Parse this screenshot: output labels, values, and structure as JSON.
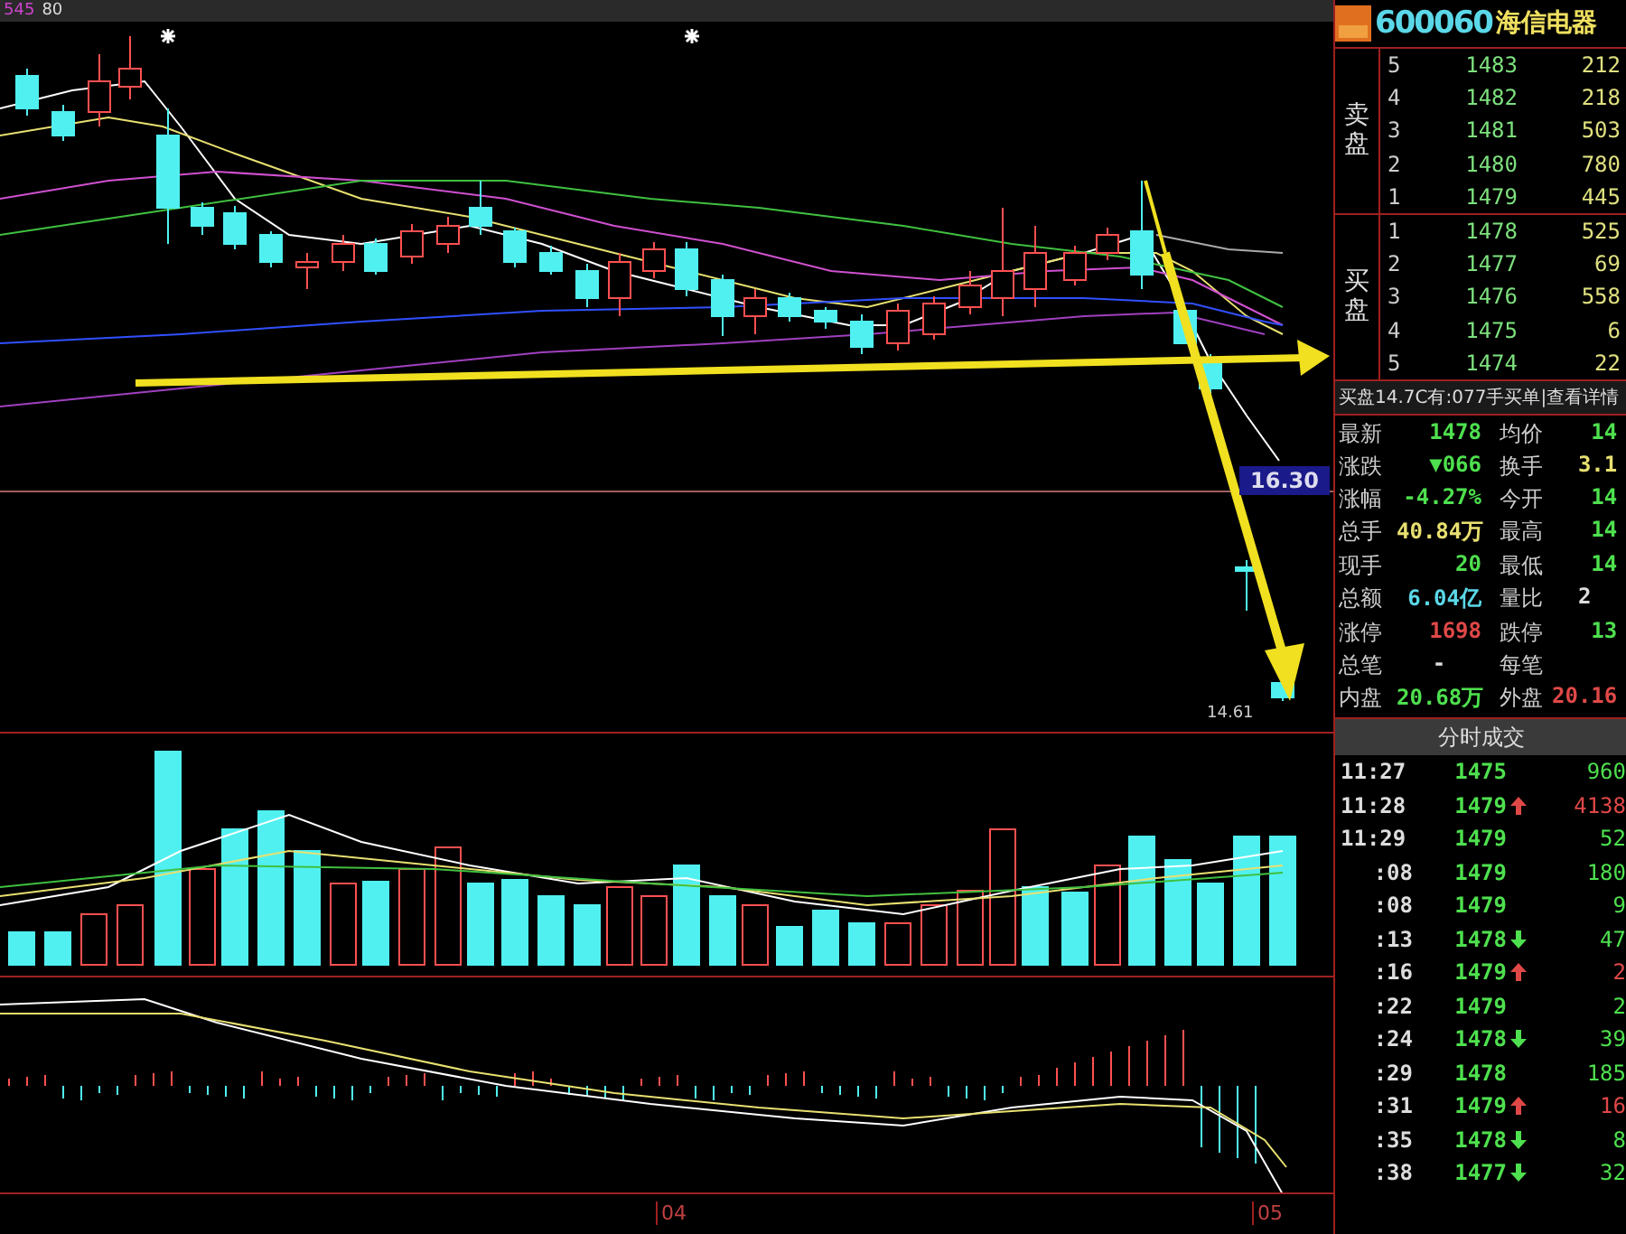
{
  "chart": {
    "ma_label": "545",
    "count_label": "80",
    "price_tag": "16.30",
    "low_label": "14.61",
    "date_labels": [
      "04",
      "05"
    ]
  },
  "quote": {
    "code": "600060",
    "name": "海信电器",
    "sell_label": "卖盘",
    "buy_label": "买盘",
    "asks": [
      {
        "level": "5",
        "price": "1483",
        "volume": "212"
      },
      {
        "level": "4",
        "price": "1482",
        "volume": "218"
      },
      {
        "level": "3",
        "price": "1481",
        "volume": "503"
      },
      {
        "level": "2",
        "price": "1480",
        "volume": "780"
      },
      {
        "level": "1",
        "price": "1479",
        "volume": "445"
      }
    ],
    "bids": [
      {
        "level": "1",
        "price": "1478",
        "volume": "525"
      },
      {
        "level": "2",
        "price": "1477",
        "volume": "69"
      },
      {
        "level": "3",
        "price": "1476",
        "volume": "558"
      },
      {
        "level": "4",
        "price": "1475",
        "volume": "6"
      },
      {
        "level": "5",
        "price": "1474",
        "volume": "22"
      }
    ],
    "info_line": "买盘14.7C有:077手买单|查看详情"
  },
  "stats": [
    {
      "label": "最新",
      "value": "1478",
      "color": "#4ee04e"
    },
    {
      "label": "均价",
      "value": "14",
      "color": "#4ee04e"
    },
    {
      "label": "涨跌",
      "value": "▼066",
      "color": "#4ee04e"
    },
    {
      "label": "换手",
      "value": "3.1",
      "color": "#e8e070"
    },
    {
      "label": "涨幅",
      "value": "-4.27%",
      "color": "#4ee04e"
    },
    {
      "label": "今开",
      "value": "14",
      "color": "#4ee04e"
    },
    {
      "label": "总手",
      "value": "40.84万",
      "color": "#e8e070"
    },
    {
      "label": "最高",
      "value": "14",
      "color": "#4ee04e"
    },
    {
      "label": "现手",
      "value": "20",
      "color": "#4ee04e"
    },
    {
      "label": "最低",
      "value": "14",
      "color": "#4ee04e"
    },
    {
      "label": "总额",
      "value": "6.04亿",
      "color": "#5bd8e8"
    },
    {
      "label": "量比",
      "value": "2",
      "color": "#dddddd"
    },
    {
      "label": "涨停",
      "value": "1698",
      "color": "#e04848"
    },
    {
      "label": "跌停",
      "value": "13",
      "color": "#4ee04e"
    },
    {
      "label": "总笔",
      "value": "-",
      "color": "#dddddd"
    },
    {
      "label": "每笔"
    },
    {
      "label": "内盘",
      "value": "20.68万",
      "color": "#4ee04e"
    },
    {
      "label": "外盘",
      "value": "20.16",
      "color": "#e04848"
    }
  ],
  "trades_tab": "分时成交",
  "trades": [
    {
      "time": "11:27",
      "price": "1475",
      "kind": "plain",
      "volume": "960",
      "color": "#4ee04e"
    },
    {
      "time": "11:28",
      "price": "1479",
      "kind": "up",
      "volume": "4138",
      "color": "#e04848"
    },
    {
      "time": "11:29",
      "price": "1479",
      "kind": "plain",
      "volume": "52",
      "color": "#4ee04e"
    },
    {
      "time": ":08",
      "price": "1479",
      "kind": "plain",
      "volume": "180",
      "color": "#4ee04e"
    },
    {
      "time": ":08",
      "price": "1479",
      "kind": "plain",
      "volume": "9",
      "color": "#4ee04e"
    },
    {
      "time": ":13",
      "price": "1478",
      "kind": "down",
      "volume": "47",
      "color": "#4ee04e"
    },
    {
      "time": ":16",
      "price": "1479",
      "kind": "up",
      "volume": "2",
      "color": "#e04848"
    },
    {
      "time": ":22",
      "price": "1479",
      "kind": "plain",
      "volume": "2",
      "color": "#4ee04e"
    },
    {
      "time": ":24",
      "price": "1478",
      "kind": "down",
      "volume": "39",
      "color": "#4ee04e"
    },
    {
      "time": ":29",
      "price": "1478",
      "kind": "plain",
      "volume": "185",
      "color": "#4ee04e"
    },
    {
      "time": ":31",
      "price": "1479",
      "kind": "up",
      "volume": "16",
      "color": "#e04848"
    },
    {
      "time": ":35",
      "price": "1478",
      "kind": "down",
      "volume": "8",
      "color": "#4ee04e"
    },
    {
      "time": ":38",
      "price": "1477",
      "kind": "down",
      "volume": "32",
      "color": "#4ee04e"
    }
  ]
}
